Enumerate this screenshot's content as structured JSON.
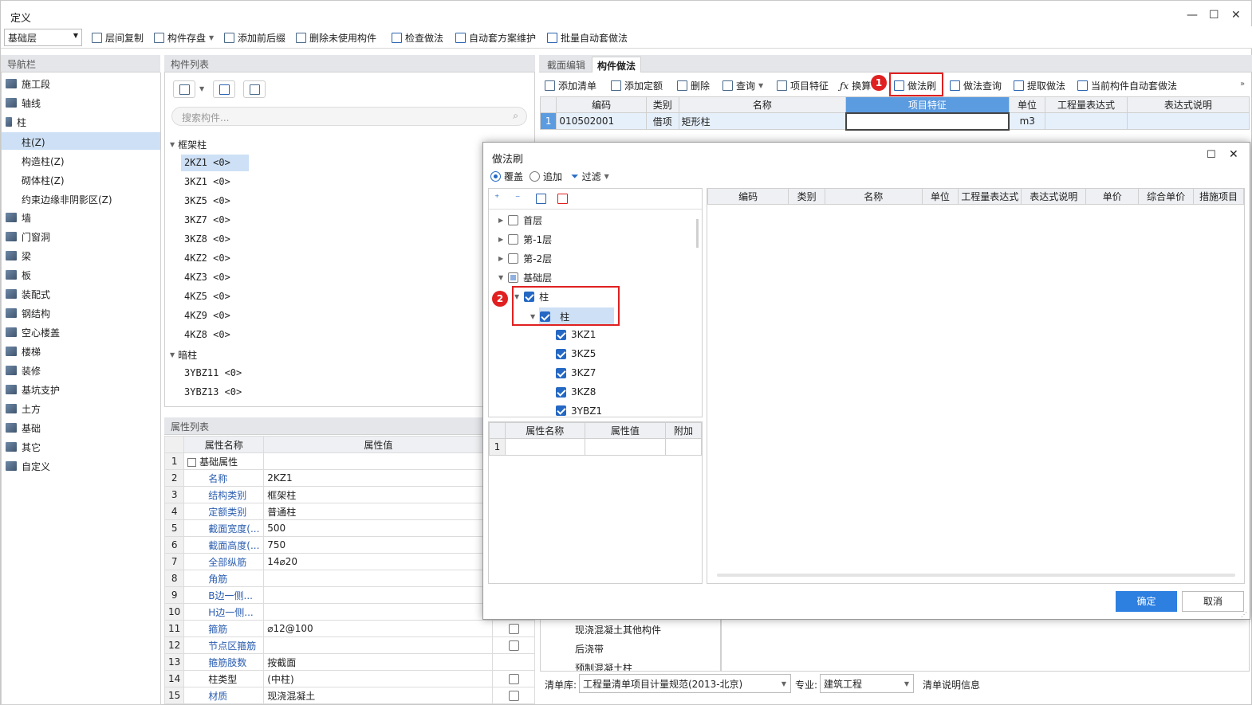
{
  "window": {
    "title": "定义"
  },
  "toolbar": {
    "floor": "基础层",
    "items": [
      "层间复制",
      "构件存盘",
      "添加前后缀",
      "删除未使用构件",
      "检查做法",
      "自动套方案维护",
      "批量自动套做法"
    ]
  },
  "nav": {
    "header": "导航栏",
    "items": [
      "施工段",
      "轴线",
      "柱",
      "墙",
      "门窗洞",
      "梁",
      "板",
      "装配式",
      "钢结构",
      "空心楼盖",
      "楼梯",
      "装修",
      "基坑支护",
      "土方",
      "基础",
      "其它",
      "自定义"
    ],
    "sub": [
      "柱(Z)",
      "构造柱(Z)",
      "砌体柱(Z)",
      "约束边缘非阴影区(Z)"
    ]
  },
  "components": {
    "header": "构件列表",
    "search_placeholder": "搜索构件...",
    "group1": "框架柱",
    "items1": [
      "2KZ1 <0>",
      "3KZ1 <0>",
      "3KZ5 <0>",
      "3KZ7 <0>",
      "3KZ8 <0>",
      "4KZ2 <0>",
      "4KZ3 <0>",
      "4KZ5 <0>",
      "4KZ9 <0>",
      "4KZ8 <0>"
    ],
    "group2": "暗柱",
    "items2": [
      "3YBZ11 <0>",
      "3YBZ13 <0>"
    ]
  },
  "props": {
    "header": "属性列表",
    "col_name": "属性名称",
    "col_value": "属性值",
    "rows": [
      {
        "n": "1",
        "name": "基础属性",
        "value": ""
      },
      {
        "n": "2",
        "name": "名称",
        "value": "2KZ1"
      },
      {
        "n": "3",
        "name": "结构类别",
        "value": "框架柱"
      },
      {
        "n": "4",
        "name": "定额类别",
        "value": "普通柱"
      },
      {
        "n": "5",
        "name": "截面宽度(...",
        "value": "500"
      },
      {
        "n": "6",
        "name": "截面高度(...",
        "value": "750"
      },
      {
        "n": "7",
        "name": "全部纵筋",
        "value": "14⌀20"
      },
      {
        "n": "8",
        "name": "角筋",
        "value": ""
      },
      {
        "n": "9",
        "name": "B边一侧...",
        "value": ""
      },
      {
        "n": "10",
        "name": "H边一侧...",
        "value": ""
      },
      {
        "n": "11",
        "name": "箍筋",
        "value": "⌀12@100"
      },
      {
        "n": "12",
        "name": "节点区箍筋",
        "value": ""
      },
      {
        "n": "13",
        "name": "箍筋肢数",
        "value": "按截面"
      },
      {
        "n": "14",
        "name": "柱类型",
        "value": "(中柱)"
      },
      {
        "n": "15",
        "name": "材质",
        "value": "现浇混凝土"
      }
    ]
  },
  "right": {
    "tabs": [
      "截面编辑",
      "构件做法"
    ],
    "tools": [
      "添加清单",
      "添加定额",
      "删除",
      "查询",
      "项目特征",
      "换算",
      "做法刷",
      "做法查询",
      "提取做法",
      "当前构件自动套做法"
    ],
    "cols": [
      "编码",
      "类别",
      "名称",
      "项目特征",
      "单位",
      "工程量表达式",
      "表达式说明"
    ],
    "row": {
      "n": "1",
      "code": "010502001",
      "type": "借项",
      "name": "矩形柱",
      "unit": "m3"
    },
    "bottom_items": [
      "现浇混凝土其他构件",
      "后浇带",
      "预制混凝土柱"
    ],
    "lib_label": "清单库:",
    "lib_value": "工程量清单项目计量规范(2013-北京)",
    "spec_label": "专业:",
    "spec_value": "建筑工程",
    "info": "清单说明信息"
  },
  "dialog": {
    "title": "做法刷",
    "opt1": "覆盖",
    "opt2": "追加",
    "filter": "过滤",
    "tree": [
      "首层",
      "第-1层",
      "第-2层",
      "基础层",
      "柱",
      "柱",
      "3KZ1",
      "3KZ5",
      "3KZ7",
      "3KZ8",
      "3YBZ1"
    ],
    "cols": [
      "编码",
      "类别",
      "名称",
      "单位",
      "工程量表达式",
      "表达式说明",
      "单价",
      "综合单价",
      "措施项目"
    ],
    "prop_cols": [
      "属性名称",
      "属性值",
      "附加"
    ],
    "prop_row": "1",
    "ok": "确定",
    "cancel": "取消"
  },
  "badges": [
    "1",
    "2"
  ]
}
